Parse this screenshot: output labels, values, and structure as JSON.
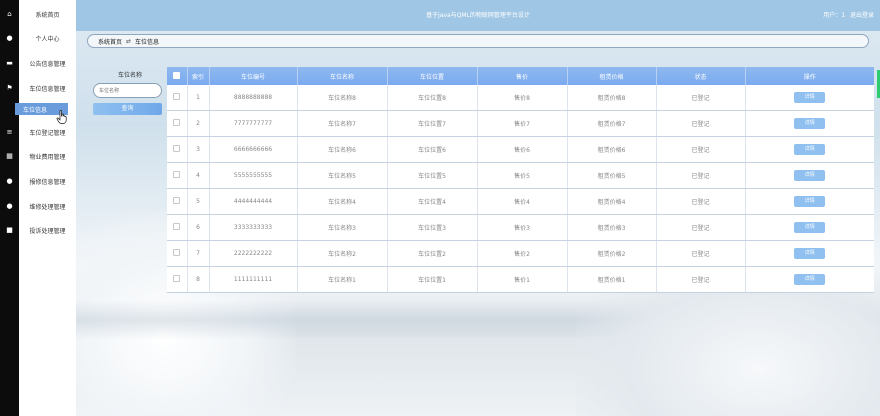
{
  "app": {
    "title": "基于java与QML的物联网管理平台设计",
    "user_label": "用户：1",
    "logout_label": "退出登录"
  },
  "sidebar": {
    "icons": [
      "home-icon",
      "person-icon",
      "message-icon",
      "flag-icon",
      "grid-icon",
      "list-icon",
      "apps-icon",
      "person-icon",
      "person-icon",
      "square-icon"
    ],
    "items": [
      {
        "label": "系统首页"
      },
      {
        "label": "个人中心"
      },
      {
        "label": "公告信息管理"
      },
      {
        "label": "车位信息管理"
      },
      {
        "label": "车位信息"
      },
      {
        "label": "车位登记管理"
      },
      {
        "label": "物业费用管理"
      },
      {
        "label": "报修信息管理"
      },
      {
        "label": "维修处理管理"
      },
      {
        "label": "投诉处理管理"
      }
    ]
  },
  "breadcrumb": {
    "home": "系统首页",
    "separator": "⇄",
    "current": "车位信息"
  },
  "search": {
    "label": "车位名称",
    "placeholder": "车位名称",
    "button": "查询"
  },
  "table": {
    "headers": [
      "",
      "索引",
      "车位编号",
      "车位名称",
      "车位位置",
      "售价",
      "租赁价格",
      "状态",
      "操作"
    ],
    "rows": [
      {
        "index": "1",
        "code": "8888888888",
        "name": "车位名称8",
        "location": "车位位置8",
        "price": "售价8",
        "rent": "租赁价格8",
        "status": "已登记",
        "action": "详情"
      },
      {
        "index": "2",
        "code": "7777777777",
        "name": "车位名称7",
        "location": "车位位置7",
        "price": "售价7",
        "rent": "租赁价格7",
        "status": "已登记",
        "action": "详情"
      },
      {
        "index": "3",
        "code": "6666666666",
        "name": "车位名称6",
        "location": "车位位置6",
        "price": "售价6",
        "rent": "租赁价格6",
        "status": "已登记",
        "action": "详情"
      },
      {
        "index": "4",
        "code": "5555555555",
        "name": "车位名称5",
        "location": "车位位置5",
        "price": "售价5",
        "rent": "租赁价格5",
        "status": "已登记",
        "action": "详情"
      },
      {
        "index": "5",
        "code": "4444444444",
        "name": "车位名称4",
        "location": "车位位置4",
        "price": "售价4",
        "rent": "租赁价格4",
        "status": "已登记",
        "action": "详情"
      },
      {
        "index": "6",
        "code": "3333333333",
        "name": "车位名称3",
        "location": "车位位置3",
        "price": "售价3",
        "rent": "租赁价格3",
        "status": "已登记",
        "action": "详情"
      },
      {
        "index": "7",
        "code": "2222222222",
        "name": "车位名称2",
        "location": "车位位置2",
        "price": "售价2",
        "rent": "租赁价格2",
        "status": "已登记",
        "action": "详情"
      },
      {
        "index": "8",
        "code": "1111111111",
        "name": "车位名称1",
        "location": "车位位置1",
        "price": "售价1",
        "rent": "租赁价格1",
        "status": "已登记",
        "action": "详情"
      }
    ]
  },
  "colors": {
    "header": "#9fc6e4",
    "table_header": "#7aaaf0",
    "active_menu": "#6a9cdb",
    "button": "#8fc0ef"
  }
}
